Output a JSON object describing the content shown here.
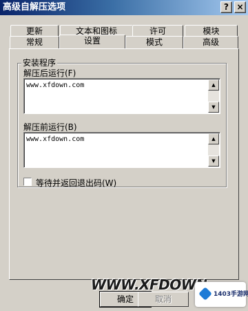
{
  "window": {
    "title": "高级自解压选项",
    "help_button": "?",
    "close_button": "×"
  },
  "tabs": {
    "row1": [
      {
        "label": "更新"
      },
      {
        "label": "文本和图标"
      },
      {
        "label": "许可"
      },
      {
        "label": "模块"
      }
    ],
    "row2": [
      {
        "label": "常规"
      },
      {
        "label": "设置",
        "selected": true
      },
      {
        "label": "模式"
      },
      {
        "label": "高级"
      }
    ]
  },
  "setup": {
    "group_label": "安装程序",
    "after_label": "解压后运行(F)",
    "after_value": "www.xfdown.com",
    "before_label": "解压前运行(B)",
    "before_value": "www.xfdown.com",
    "wait_checkbox_label": "等待并返回退出码(W)",
    "wait_checked": false
  },
  "buttons": {
    "ok": "确定",
    "cancel": "取消"
  },
  "overlay": {
    "watermark": "WWW.XFDOWN",
    "badge": "1403手游网"
  }
}
